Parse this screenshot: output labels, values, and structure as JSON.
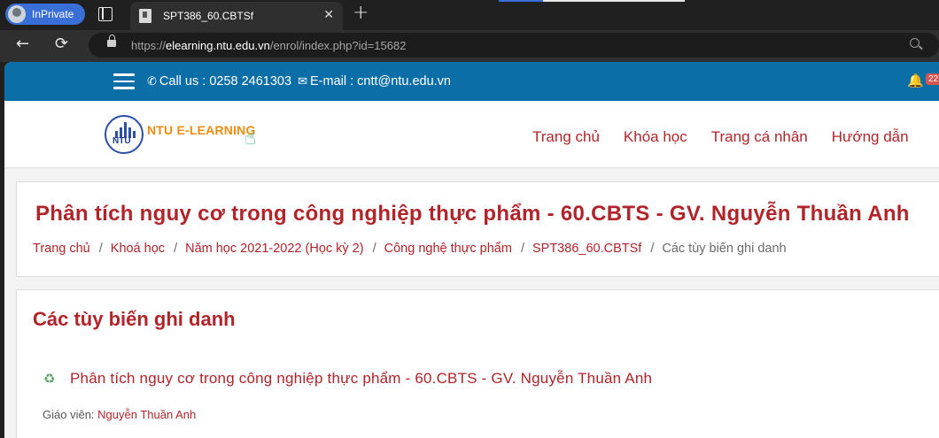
{
  "browser": {
    "profile_label": "InPrivate",
    "tab_title": "SPT386_60.CBTSf",
    "tab_close": "✕",
    "new_tab": "+",
    "url_prefix": "https://",
    "url_host": "elearning.ntu.edu.vn",
    "url_path": "/enrol/index.php?id=15682"
  },
  "topbar": {
    "call_label": "Call us : 0258 2461303",
    "email_label": "E-mail : cntt@ntu.edu.vn",
    "notification_count": "22"
  },
  "header": {
    "logo_text": "NTU E-LEARNING",
    "logo_mark": "NTU",
    "nav": [
      "Trang chủ",
      "Khóa học",
      "Trang cá nhân",
      "Hướng dẫn"
    ]
  },
  "course": {
    "title": "Phân tích nguy cơ trong công nghiệp thực phẩm - 60.CBTS - GV. Nguyễn Thuần Anh"
  },
  "breadcrumb": {
    "items": [
      "Trang chủ",
      "Khoá học",
      "Năm học 2021-2022 (Học kỳ 2)",
      "Công nghệ thực phẩm",
      "SPT386_60.CBTSf"
    ],
    "current": "Các tùy biến ghi danh",
    "separator": "/"
  },
  "enrol": {
    "heading": "Các tùy biến ghi danh",
    "course_link": "Phân tích nguy cơ trong công nghiệp thực phẩm - 60.CBTS - GV. Nguyễn Thuần Anh",
    "teacher_label": "Giáo viên:",
    "teacher_name": "Nguyễn Thuần Anh"
  },
  "icons": {
    "topbar_phone": "phone-icon",
    "topbar_email": "envelope-icon",
    "notification": "bell-icon",
    "course": "recycle-icon"
  },
  "colors": {
    "topbar": "#0b6ea7",
    "link": "#b0242a",
    "logo_orange": "#f08c10"
  }
}
